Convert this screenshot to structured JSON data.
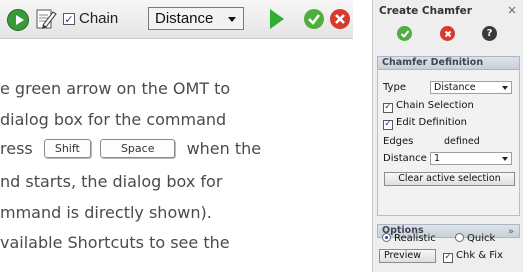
{
  "toolbar": {
    "chain_label": "Chain",
    "chain_checked": true,
    "type_value": "Distance",
    "icons": [
      "play-circle-icon",
      "edit-definition-icon",
      "chevron-down-icon",
      "play-icon",
      "checkmark-icon",
      "cancel-icon"
    ],
    "colors": {
      "green": "#2fae2f",
      "red": "#d83a30"
    }
  },
  "body": {
    "lines": [
      "e green arrow on the OMT to",
      " dialog box for the command",
      "ress",
      "when the",
      "nd starts, the dialog box for",
      "mmand is directly shown).",
      "vailable Shortcuts to see the"
    ],
    "keys": [
      "Shift",
      "Space"
    ]
  },
  "dialog": {
    "title": "Create Chamfer",
    "close_glyph": "×",
    "help_glyph": "?",
    "chamfer_definition": {
      "header": "Chamfer Definition",
      "type_label": "Type",
      "type_value": "Distance",
      "chain_selection": "Chain Selection",
      "edit_definition": "Edit Definition",
      "edges_label": "Edges",
      "edges_value": "defined",
      "distance_label": "Distance",
      "distance_value": "1",
      "clear_button": "Clear active selection"
    },
    "options": {
      "header": "Options",
      "realistic": "Realistic",
      "quick": "Quick",
      "selected": "Realistic"
    },
    "preview_button": "Preview",
    "chk_fix": "Chk & Fix"
  }
}
